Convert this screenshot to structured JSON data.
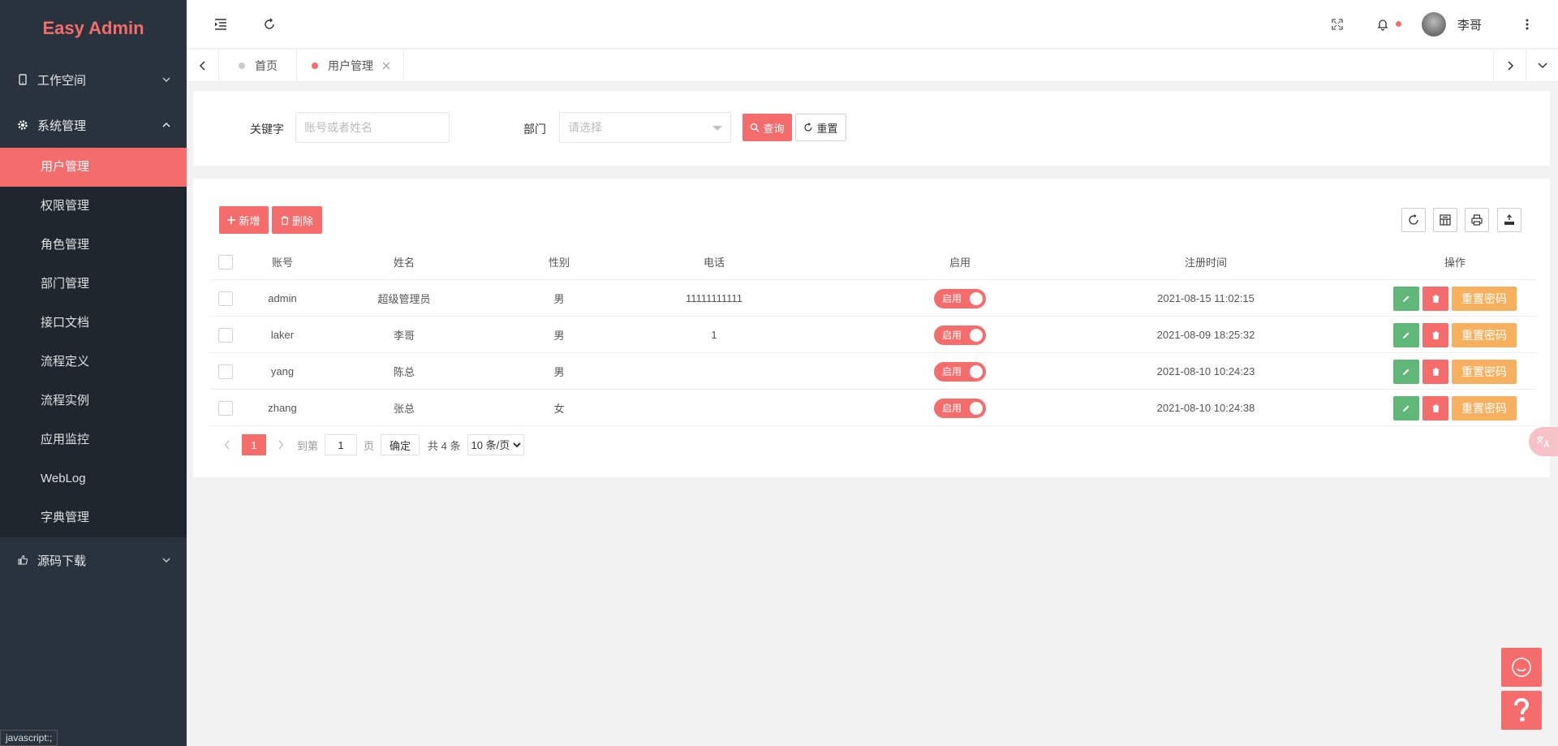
{
  "app": {
    "title": "Easy Admin"
  },
  "sidebar": {
    "groups": [
      {
        "label": "工作空间",
        "icon": "tablet-icon",
        "expanded": false
      },
      {
        "label": "系统管理",
        "icon": "gear-icon",
        "expanded": true
      },
      {
        "label": "源码下载",
        "icon": "thumbs-up-icon",
        "expanded": false
      }
    ],
    "items": [
      {
        "label": "用户管理",
        "active": true
      },
      {
        "label": "权限管理"
      },
      {
        "label": "角色管理"
      },
      {
        "label": "部门管理"
      },
      {
        "label": "接口文档"
      },
      {
        "label": "流程定义"
      },
      {
        "label": "流程实例"
      },
      {
        "label": "应用监控"
      },
      {
        "label": "WebLog"
      },
      {
        "label": "字典管理"
      }
    ]
  },
  "header": {
    "user_name": "李哥"
  },
  "tabs": [
    {
      "label": "首页"
    },
    {
      "label": "用户管理",
      "active": true
    }
  ],
  "search": {
    "keyword_label": "关键字",
    "keyword_placeholder": "账号或者姓名",
    "dept_label": "部门",
    "dept_placeholder": "请选择",
    "query_label": "查询",
    "reset_label": "重置"
  },
  "toolbar": {
    "add_label": "新增",
    "delete_label": "删除"
  },
  "table": {
    "columns": [
      "账号",
      "姓名",
      "性别",
      "电话",
      "启用",
      "注册时间",
      "操作"
    ],
    "switch_label": "启用",
    "reset_pwd_label": "重置密码",
    "rows": [
      {
        "account": "admin",
        "name": "超级管理员",
        "gender": "男",
        "phone": "11111111111",
        "enabled": true,
        "registered": "2021-08-15 11:02:15"
      },
      {
        "account": "laker",
        "name": "李哥",
        "gender": "男",
        "phone": "1",
        "enabled": true,
        "registered": "2021-08-09 18:25:32"
      },
      {
        "account": "yang",
        "name": "陈总",
        "gender": "男",
        "phone": "",
        "enabled": true,
        "registered": "2021-08-10 10:24:23"
      },
      {
        "account": "zhang",
        "name": "张总",
        "gender": "女",
        "phone": "",
        "enabled": true,
        "registered": "2021-08-10 10:24:38"
      }
    ]
  },
  "pagination": {
    "current": "1",
    "goto_label": "到第",
    "goto_value": "1",
    "page_label": "页",
    "confirm_label": "确定",
    "total_text": "共 4 条",
    "page_size": "10 条/页"
  },
  "status_hint": "javascript:;",
  "colors": {
    "accent": "#f56c6c",
    "sidebar_bg": "#28333e",
    "edit_green": "#5fb878",
    "reset_orange": "#f7b05d"
  }
}
